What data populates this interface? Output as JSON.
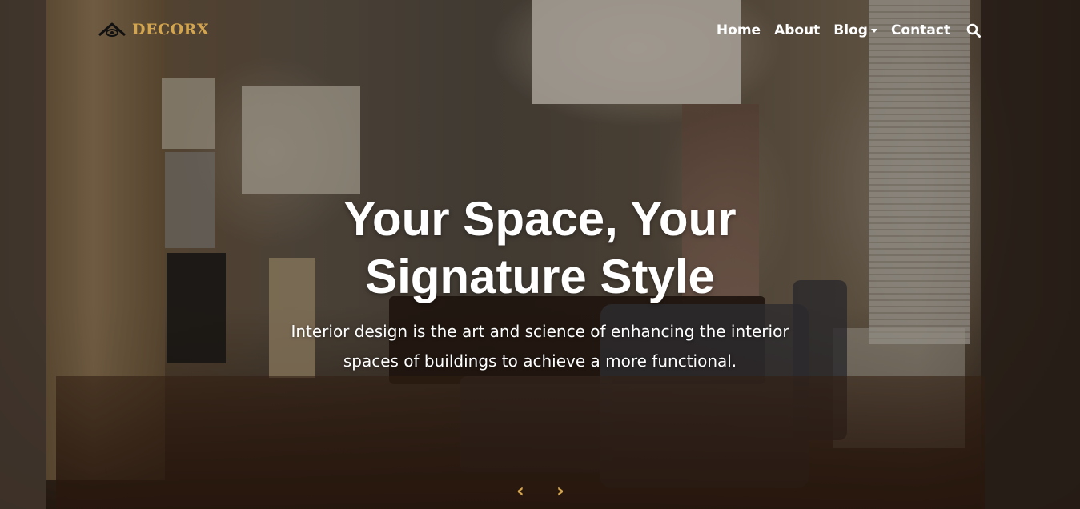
{
  "brand": {
    "name": "DECORX",
    "icon": "roof-eye-logo-icon",
    "color": "#d3a54e"
  },
  "nav": {
    "items": [
      {
        "label": "Home"
      },
      {
        "label": "About"
      },
      {
        "label": "Blog",
        "has_dropdown": true
      },
      {
        "label": "Contact"
      }
    ],
    "search_icon": "search-icon"
  },
  "hero": {
    "title": "Your Space, Your Signature Style",
    "subtitle": "Interior design is the art and science of enhancing the interior spaces of buildings to achieve a more functional."
  },
  "carousel": {
    "prev_label": "‹",
    "next_label": "›",
    "accent_color": "#d3a54e"
  }
}
